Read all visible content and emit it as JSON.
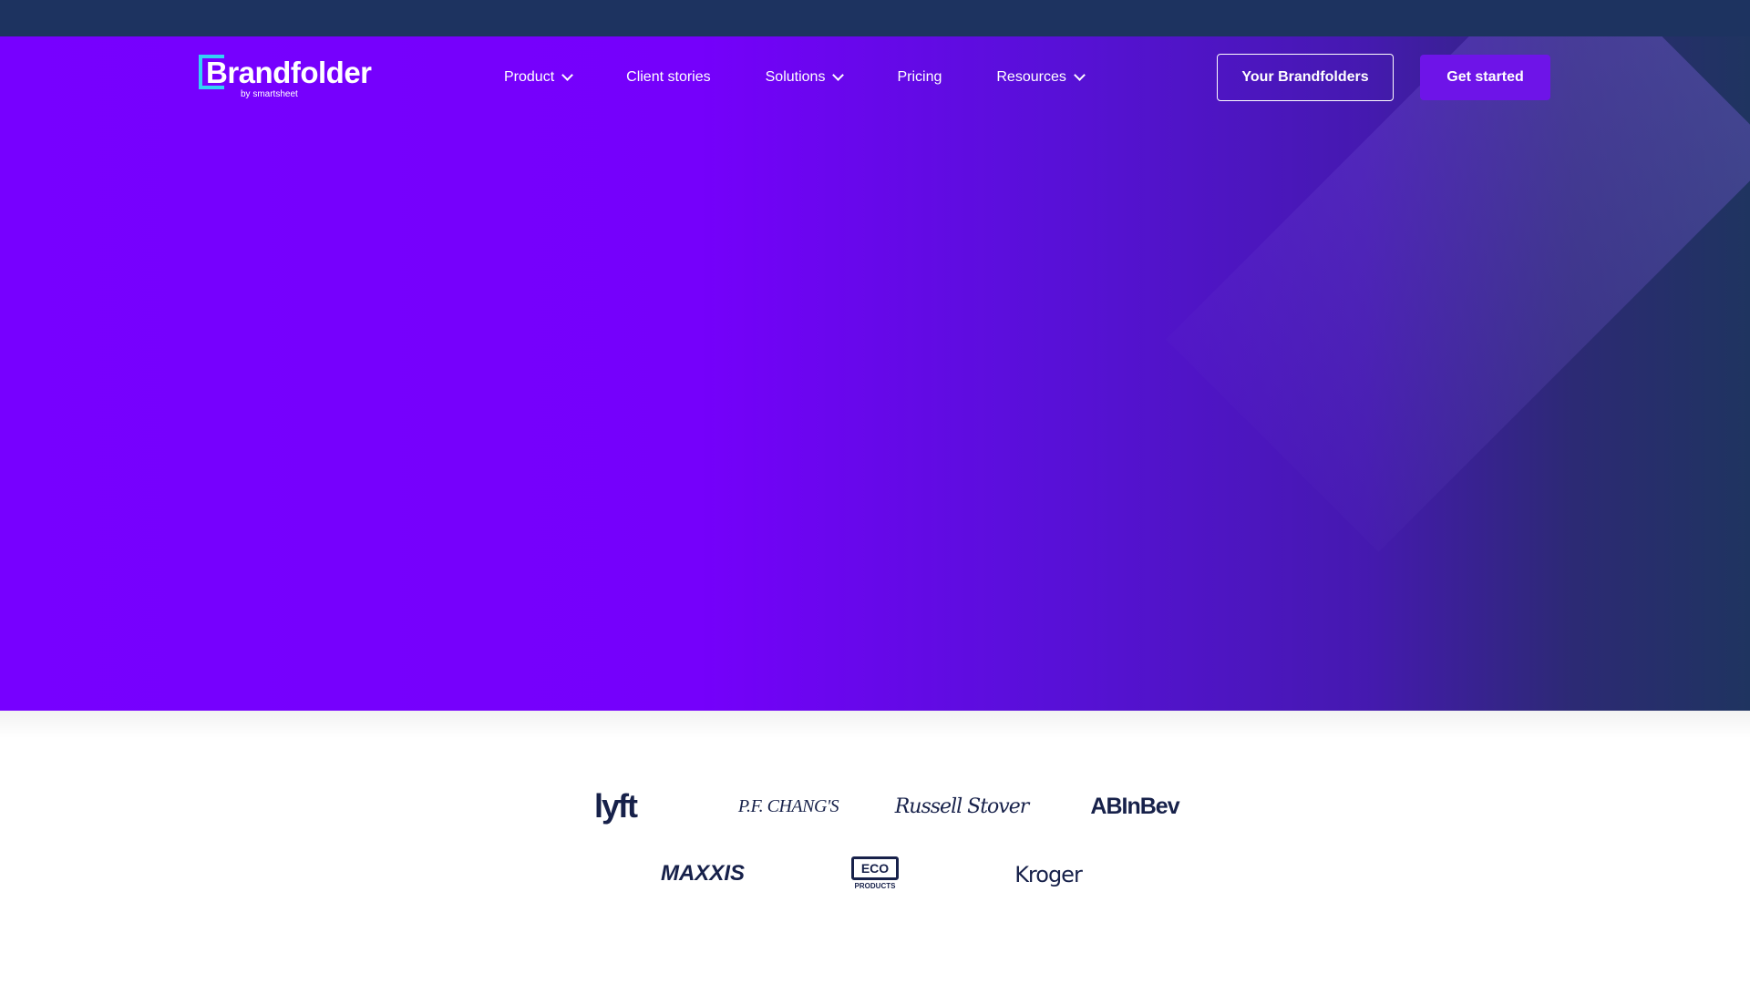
{
  "brand": {
    "name": "Brandfolder",
    "tagline": "by smartsheet",
    "accent_color": "#33d2f5"
  },
  "nav": {
    "items": [
      {
        "label": "Product",
        "has_dropdown": true
      },
      {
        "label": "Client stories",
        "has_dropdown": false
      },
      {
        "label": "Solutions",
        "has_dropdown": true
      },
      {
        "label": "Pricing",
        "has_dropdown": false
      },
      {
        "label": "Resources",
        "has_dropdown": true
      }
    ],
    "your_brandfolders_label": "Your Brandfolders",
    "get_started_label": "Get started"
  },
  "colors": {
    "topbar": "#1d3360",
    "hero_start": "#7700ff",
    "hero_end": "#1f3460",
    "cta": "#6e14e8",
    "logo_ink": "#17214a"
  },
  "clients": {
    "row1": [
      "lyft",
      "P.F. CHANG'S",
      "Russell Stover",
      "ABInBev"
    ],
    "row2": [
      "MAXXIS",
      "ECO",
      "PRODUCTS",
      "Kroger"
    ]
  }
}
